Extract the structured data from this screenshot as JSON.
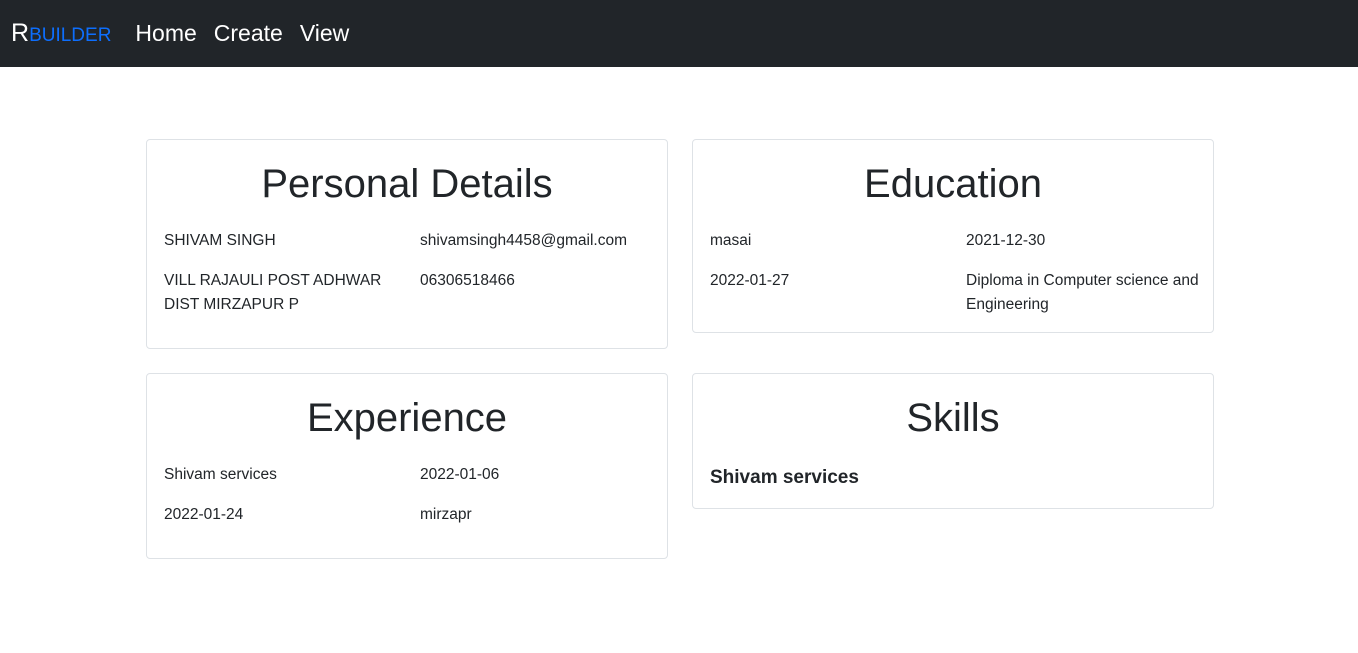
{
  "navbar": {
    "brand_first": "R",
    "brand_rest": "BUILDER",
    "links": [
      "Home",
      "Create",
      "View"
    ]
  },
  "personal": {
    "title": "Personal Details",
    "name": "SHIVAM SINGH",
    "email": "shivamsingh4458@gmail.com",
    "address": "VILL RAJAULI POST ADHWAR DIST MIRZAPUR P",
    "phone": "06306518466"
  },
  "education": {
    "title": "Education",
    "institute": "masai",
    "start_date": "2021-12-30",
    "end_date": "2022-01-27",
    "degree": "Diploma in Computer science and Engineering"
  },
  "experience": {
    "title": "Experience",
    "company": "Shivam services",
    "start_date": "2022-01-06",
    "end_date": "2022-01-24",
    "location": "mirzapr"
  },
  "skills": {
    "title": "Skills",
    "items": [
      "Shivam services"
    ]
  },
  "colors": {
    "navbar_bg": "#212529",
    "brand_accent": "#0d6efd",
    "card_border": "#dee2e6"
  }
}
